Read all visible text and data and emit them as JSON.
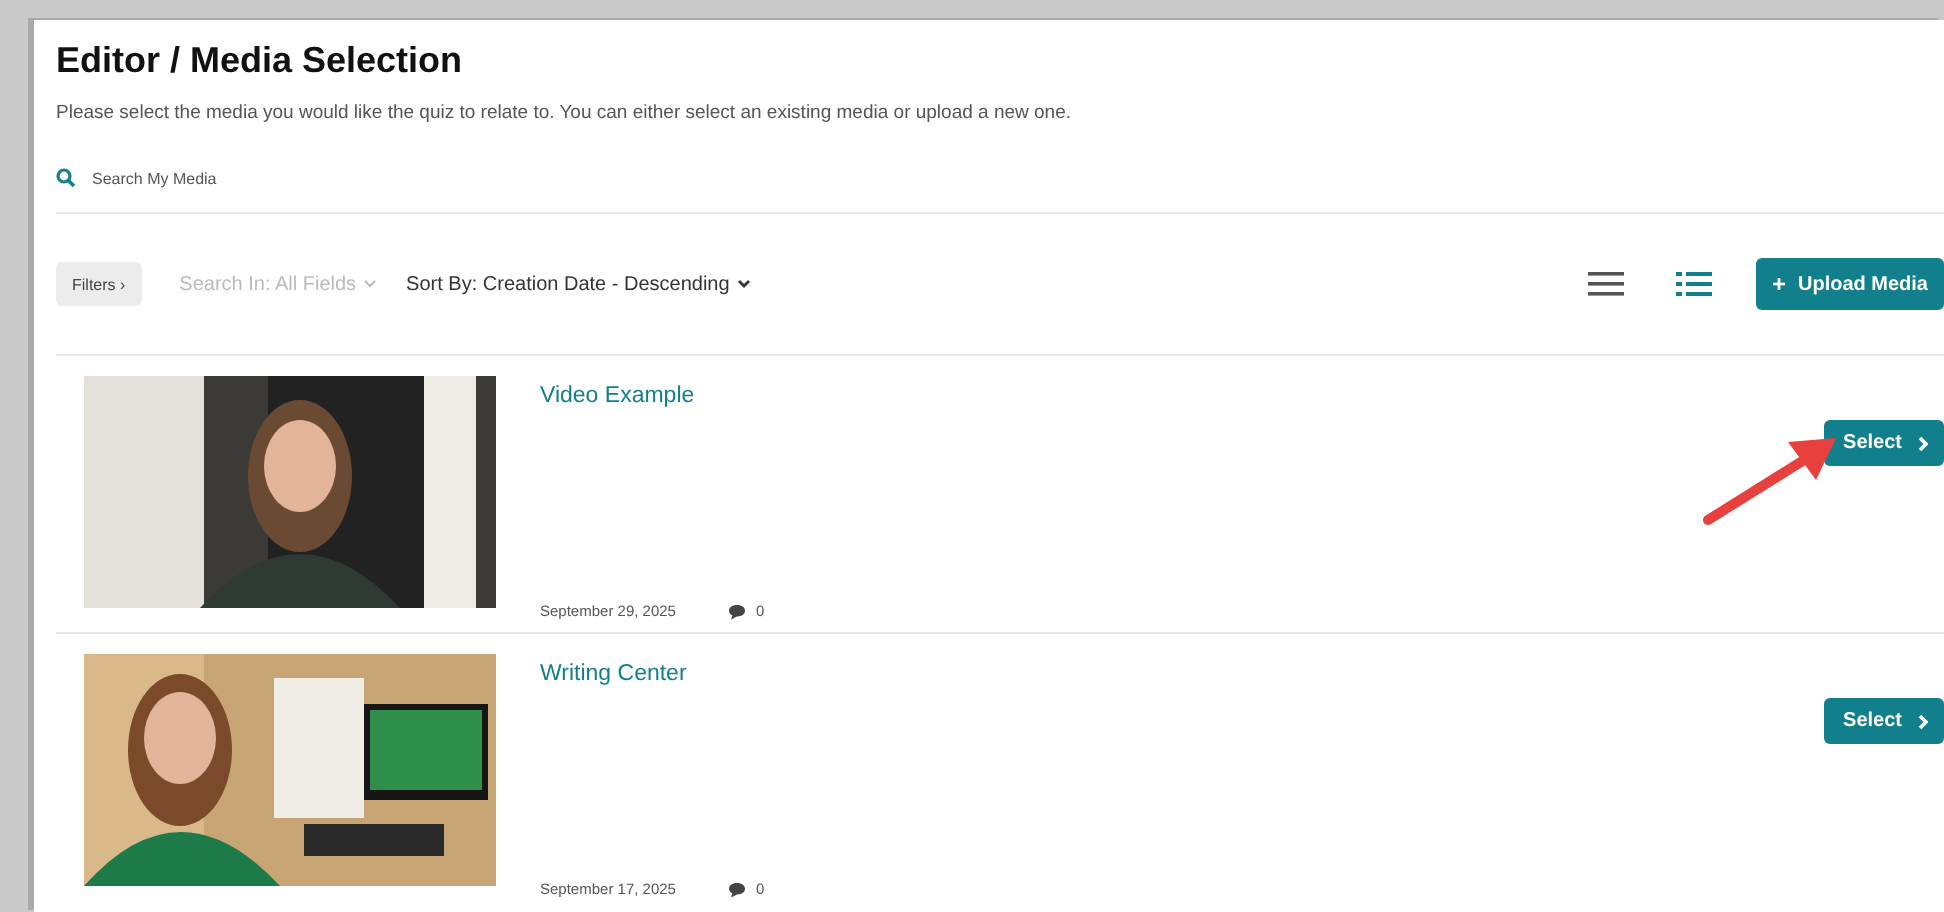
{
  "page": {
    "title": "Editor / Media Selection",
    "description": "Please select the media you would like the quiz to relate to. You can either select an existing media or upload a new one."
  },
  "search": {
    "placeholder": "Search My Media"
  },
  "toolbar": {
    "filters_button": "Filters ›",
    "search_in": "Search In: All Fields",
    "sort_by": "Sort By: Creation Date - Descending",
    "upload_button": "Upload Media",
    "upload_icon": "+"
  },
  "views": [
    {
      "kind": "compact",
      "selected": false
    },
    {
      "kind": "detailed",
      "selected": true
    }
  ],
  "media": [
    {
      "title": "Video Example",
      "date": "September 29, 2025",
      "comments": "0",
      "select_button": "Select",
      "arrow_pointing": true
    },
    {
      "title": "Writing Center",
      "date": "September 17, 2025",
      "comments": "0",
      "select_button": "Select",
      "arrow_pointing": false
    }
  ]
}
